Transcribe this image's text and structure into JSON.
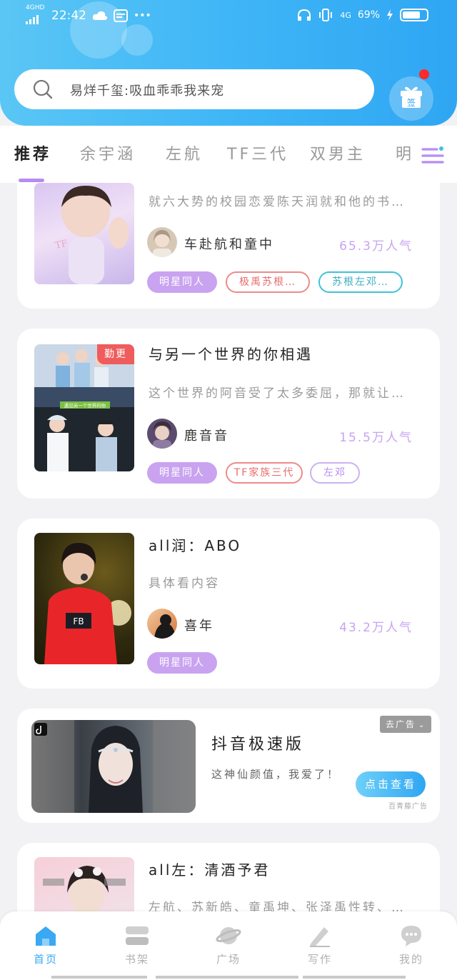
{
  "status_bar": {
    "network": "4GHD",
    "time": "22:42",
    "dots": "•••",
    "net_right": "4G",
    "battery": "69%"
  },
  "search": {
    "placeholder": "易烊千玺:吸血乖乖我来宠"
  },
  "signin": {
    "label": "签"
  },
  "tabs": [
    {
      "label": "推荐",
      "active": true
    },
    {
      "label": "余宇涵",
      "active": false
    },
    {
      "label": "左航",
      "active": false
    },
    {
      "label": "TF三代",
      "active": false
    },
    {
      "label": "双男主",
      "active": false
    },
    {
      "label": "明",
      "active": false
    }
  ],
  "cards": [
    {
      "title": "",
      "desc": "就六大势的校园恋爱陈天润就和他的书…",
      "author": "车赴航和童中",
      "popularity": "65.3万人气",
      "tags": [
        "明星同人",
        "极禹苏根…",
        "苏根左邓…"
      ]
    },
    {
      "title": "与另一个世界的你相遇",
      "badge": "勤更",
      "cover_caption": "遇见另一个世界的你",
      "desc": "这个世界的阿音受了太多委屈，那就让…",
      "author": "鹿音音",
      "popularity": "15.5万人气",
      "tags": [
        "明星同人",
        "TF家族三代",
        "左邓"
      ]
    },
    {
      "title": "all润：ABO",
      "desc": "具体看内容",
      "author": "喜年",
      "popularity": "43.2万人气",
      "tags": [
        "明星同人"
      ]
    },
    {
      "title": "all左：清酒予君",
      "desc": "左航、苏新皓、童禹坤、张泽禹性转、…"
    }
  ],
  "ad": {
    "title": "抖音极速版",
    "desc": "这神仙颜值，我爱了！",
    "button": "点击查看",
    "close": "去广告",
    "source": "百青藤广告"
  },
  "bottom_nav": [
    {
      "label": "首页",
      "icon": "home-icon",
      "active": true
    },
    {
      "label": "书架",
      "icon": "bookshelf-icon",
      "active": false
    },
    {
      "label": "广场",
      "icon": "planet-icon",
      "active": false
    },
    {
      "label": "写作",
      "icon": "pen-icon",
      "active": false
    },
    {
      "label": "我的",
      "icon": "chat-icon",
      "active": false
    }
  ],
  "colors": {
    "accent": "#2fa6f3",
    "tag_fill": "#c9a3f0",
    "popularity": "#c7a4f3",
    "badge": "#ef5c5c"
  }
}
